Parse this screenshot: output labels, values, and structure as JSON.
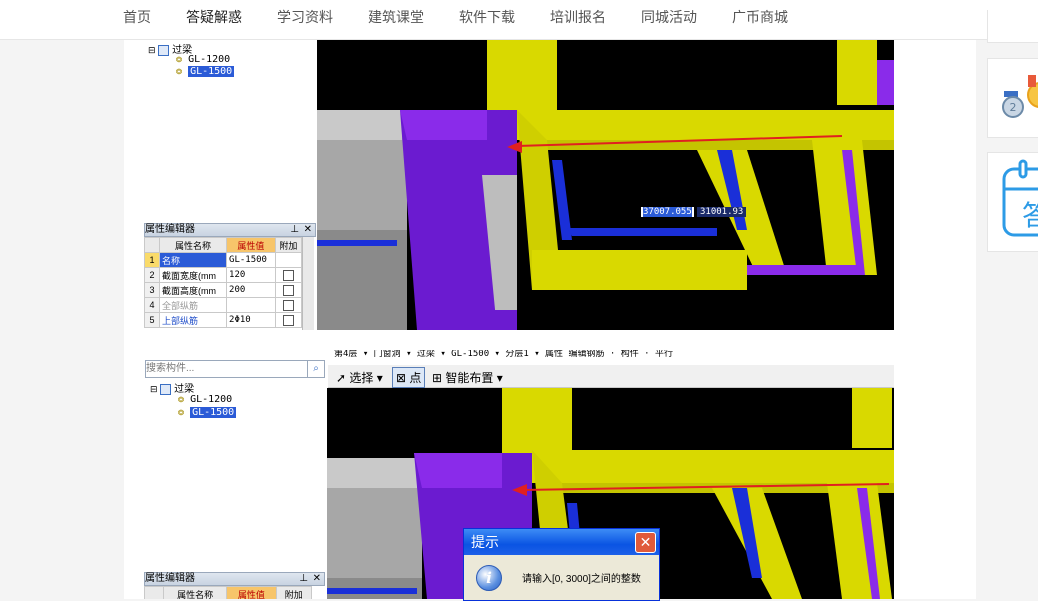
{
  "nav": {
    "items": [
      "首页",
      "答疑解惑",
      "学习资料",
      "建筑课堂",
      "软件下载",
      "培训报名",
      "同城活动",
      "广币商城"
    ],
    "active_index": 1
  },
  "shot1": {
    "tree_root": "过梁",
    "tree_items": [
      "GL-1200",
      "GL-1500"
    ],
    "selected_item": "GL-1500",
    "prop_editor_title": "属性编辑器",
    "prop_header": [
      "属性名称",
      "属性值",
      "附加"
    ],
    "props": [
      {
        "num": "1",
        "name": "名称",
        "value": "GL-1500"
      },
      {
        "num": "2",
        "name": "截面宽度(mm",
        "value": "120"
      },
      {
        "num": "3",
        "name": "截面高度(mm",
        "value": "200"
      },
      {
        "num": "4",
        "name": "全部纵筋",
        "value": ""
      },
      {
        "num": "5",
        "name": "上部纵筋",
        "value": "2Φ10"
      }
    ],
    "coord_x": "37007.055",
    "coord_y": "31001.93"
  },
  "shot2": {
    "search_placeholder": "搜索构件...",
    "toolbar_top": "第4层 ▾ 门窗洞 ▾ 过梁 ▾ GL-1500 ▾ 分层1 ▾ 属性 编辑钢筋 · 构件 · 平行",
    "select_label": "选择",
    "point_label": "点",
    "smart_label": "智能布置",
    "tree_root": "过梁",
    "tree_items": [
      "GL-1200",
      "GL-1500"
    ],
    "selected_item": "GL-1500",
    "prop_editor_title": "属性编辑器",
    "prop_header": [
      "属性名称",
      "属性值",
      "附加"
    ]
  },
  "dialog": {
    "title": "提示",
    "message": "请输入[0, 3000]之间的整数",
    "close_glyph": "✕",
    "icon_glyph": "i"
  },
  "colors": {
    "yellow": "#d9d900",
    "purple": "#7a1ee0",
    "blue": "#0a1fd6",
    "arrow": "#e02020"
  }
}
